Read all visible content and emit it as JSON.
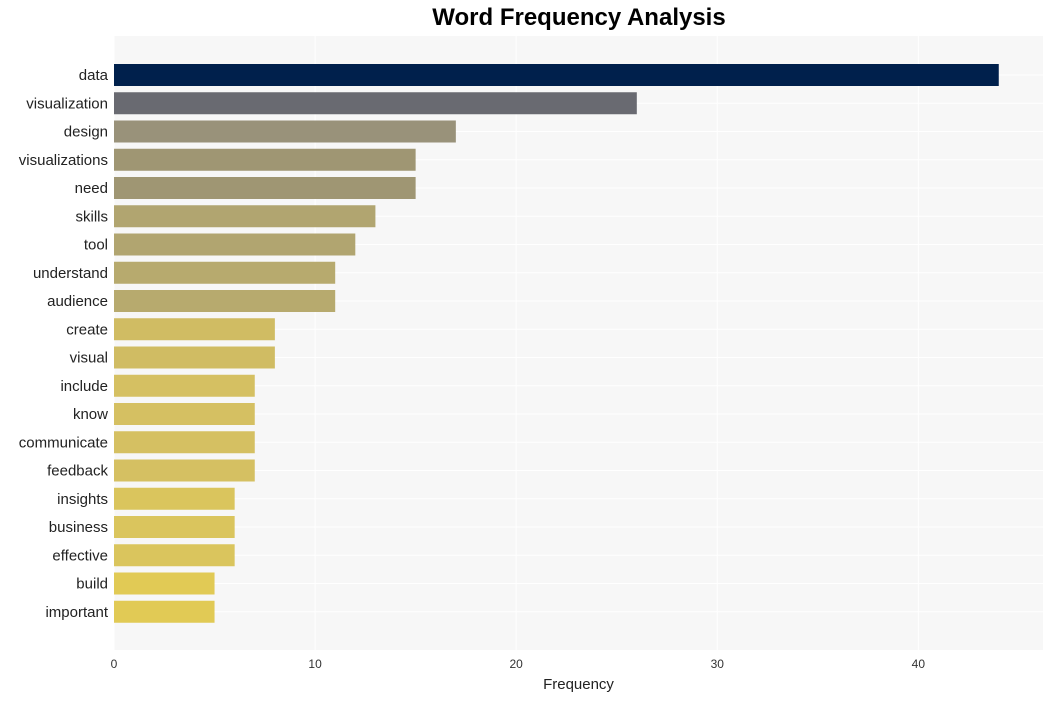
{
  "chart_data": {
    "type": "bar",
    "orientation": "horizontal",
    "title": "Word Frequency Analysis",
    "xlabel": "Frequency",
    "ylabel": "",
    "xlim": [
      0,
      46.2
    ],
    "xticks": [
      0,
      10,
      20,
      30,
      40
    ],
    "grid": true,
    "legend": "none",
    "categories": [
      "data",
      "visualization",
      "design",
      "visualizations",
      "need",
      "skills",
      "tool",
      "understand",
      "audience",
      "create",
      "visual",
      "include",
      "know",
      "communicate",
      "feedback",
      "insights",
      "business",
      "effective",
      "build",
      "important"
    ],
    "values": [
      44,
      26,
      17,
      15,
      15,
      13,
      12,
      11,
      11,
      8,
      8,
      7,
      7,
      7,
      7,
      6,
      6,
      6,
      5,
      5
    ],
    "colors": [
      "#00204c",
      "#696a71",
      "#99927a",
      "#9f9673",
      "#9f9673",
      "#b1a570",
      "#b1a570",
      "#b7aa6e",
      "#b7aa6e",
      "#d0bc63",
      "#d0bc63",
      "#d5c062",
      "#d5c062",
      "#d5c062",
      "#d5c062",
      "#dac55d",
      "#dac55d",
      "#dac55d",
      "#e1ca55",
      "#e1ca55"
    ]
  },
  "style": {
    "plot_background": "#f7f7f7",
    "grid_color": "#ffffff"
  }
}
